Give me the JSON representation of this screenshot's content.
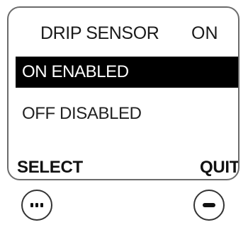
{
  "header": {
    "title": "DRIP SENSOR",
    "state": "ON"
  },
  "menu": {
    "items": [
      {
        "label": "ON ENABLED",
        "selected": true
      },
      {
        "label": "OFF DISABLED",
        "selected": false
      }
    ]
  },
  "softkeys": {
    "left_label": "SELECT",
    "right_label": "QUIT"
  },
  "buttons": {
    "left_icon": "dotted-dash-icon",
    "right_icon": "dash-icon"
  }
}
